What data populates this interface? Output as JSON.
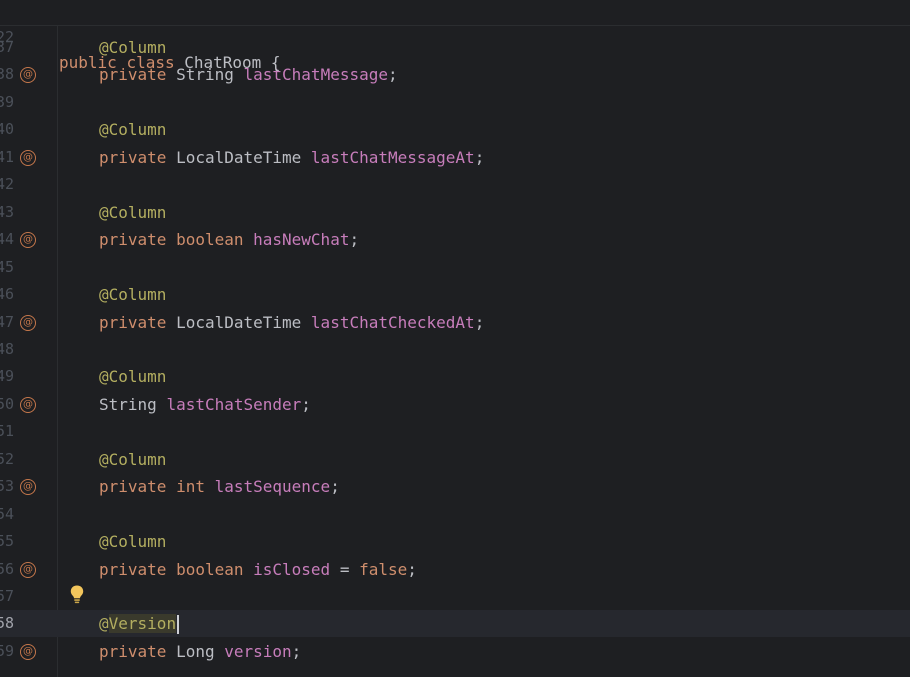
{
  "sticky_header": {
    "line_number": "22",
    "tokens": [
      {
        "text": "public ",
        "kind": "kw"
      },
      {
        "text": "class ",
        "kind": "kw"
      },
      {
        "text": "ChatRoom {",
        "kind": "plain"
      }
    ]
  },
  "lines": [
    {
      "n": "37",
      "tokens": [
        {
          "text": "@Column",
          "kind": "ann"
        }
      ]
    },
    {
      "n": "38",
      "badge": "@",
      "tokens": [
        {
          "text": "private ",
          "kind": "kw"
        },
        {
          "text": "String ",
          "kind": "plain"
        },
        {
          "text": "lastChatMessage",
          "kind": "field"
        },
        {
          "text": ";",
          "kind": "plain"
        }
      ]
    },
    {
      "n": "39",
      "tokens": []
    },
    {
      "n": "40",
      "tokens": [
        {
          "text": "@Column",
          "kind": "ann"
        }
      ]
    },
    {
      "n": "41",
      "badge": "@",
      "tokens": [
        {
          "text": "private ",
          "kind": "kw"
        },
        {
          "text": "LocalDateTime ",
          "kind": "plain"
        },
        {
          "text": "lastChatMessageAt",
          "kind": "field"
        },
        {
          "text": ";",
          "kind": "plain"
        }
      ]
    },
    {
      "n": "42",
      "tokens": []
    },
    {
      "n": "43",
      "tokens": [
        {
          "text": "@Column",
          "kind": "ann"
        }
      ]
    },
    {
      "n": "44",
      "badge": "@",
      "tokens": [
        {
          "text": "private ",
          "kind": "kw"
        },
        {
          "text": "boolean ",
          "kind": "kw"
        },
        {
          "text": "hasNewChat",
          "kind": "field"
        },
        {
          "text": ";",
          "kind": "plain"
        }
      ]
    },
    {
      "n": "45",
      "tokens": []
    },
    {
      "n": "46",
      "tokens": [
        {
          "text": "@Column",
          "kind": "ann"
        }
      ]
    },
    {
      "n": "47",
      "badge": "@",
      "tokens": [
        {
          "text": "private ",
          "kind": "kw"
        },
        {
          "text": "LocalDateTime ",
          "kind": "plain"
        },
        {
          "text": "lastChatCheckedAt",
          "kind": "field"
        },
        {
          "text": ";",
          "kind": "plain"
        }
      ]
    },
    {
      "n": "48",
      "tokens": []
    },
    {
      "n": "49",
      "tokens": [
        {
          "text": "@Column",
          "kind": "ann"
        }
      ]
    },
    {
      "n": "50",
      "badge": "@",
      "tokens": [
        {
          "text": "String ",
          "kind": "plain"
        },
        {
          "text": "lastChatSender",
          "kind": "field"
        },
        {
          "text": ";",
          "kind": "plain"
        }
      ]
    },
    {
      "n": "51",
      "tokens": []
    },
    {
      "n": "52",
      "tokens": [
        {
          "text": "@Column",
          "kind": "ann"
        }
      ]
    },
    {
      "n": "53",
      "badge": "@",
      "tokens": [
        {
          "text": "private ",
          "kind": "kw"
        },
        {
          "text": "int ",
          "kind": "kw"
        },
        {
          "text": "lastSequence",
          "kind": "field"
        },
        {
          "text": ";",
          "kind": "plain"
        }
      ]
    },
    {
      "n": "54",
      "tokens": []
    },
    {
      "n": "55",
      "tokens": [
        {
          "text": "@Column",
          "kind": "ann"
        }
      ]
    },
    {
      "n": "56",
      "badge": "@",
      "tokens": [
        {
          "text": "private ",
          "kind": "kw"
        },
        {
          "text": "boolean ",
          "kind": "kw"
        },
        {
          "text": "isClosed",
          "kind": "field"
        },
        {
          "text": " = ",
          "kind": "plain"
        },
        {
          "text": "false",
          "kind": "kw"
        },
        {
          "text": ";",
          "kind": "plain"
        }
      ]
    },
    {
      "n": "57",
      "tokens": []
    },
    {
      "n": "58",
      "current": true,
      "tokens": [
        {
          "text": "@",
          "kind": "ann"
        },
        {
          "text": "Version",
          "kind": "ann",
          "highlight": true
        }
      ]
    },
    {
      "n": "59",
      "badge": "@",
      "tokens": [
        {
          "text": "private ",
          "kind": "kw"
        },
        {
          "text": "Long ",
          "kind": "plain"
        },
        {
          "text": "version",
          "kind": "field"
        },
        {
          "text": ";",
          "kind": "plain"
        }
      ]
    }
  ],
  "icons": {
    "gutter_badge": "annotation-at-icon",
    "intention": "lightbulb-icon"
  },
  "colors": {
    "background": "#1e1f22",
    "keyword": "#cf8e6d",
    "annotation": "#b3ae60",
    "field": "#c77dbb",
    "text": "#bcbec4",
    "line_number": "#4b5059",
    "badge": "#c5774b",
    "lightbulb": "#f2c55c"
  }
}
